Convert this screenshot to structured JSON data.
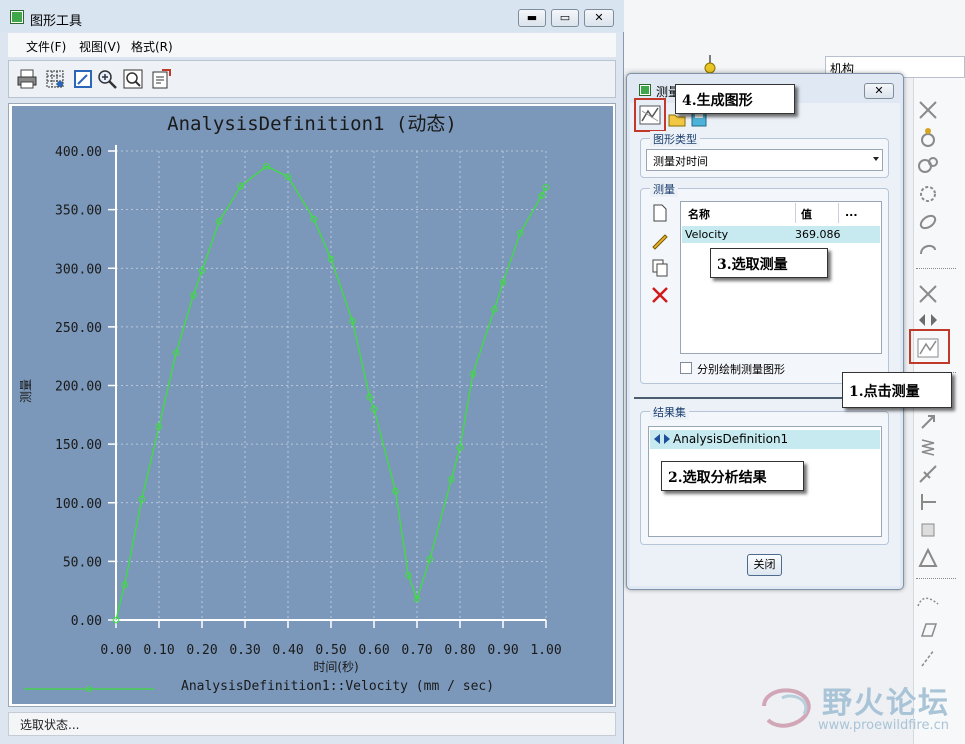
{
  "background_app": {
    "tree_label": "机构",
    "watermark": {
      "site_name": "野火论坛",
      "url": "www.proewildfire.cn"
    }
  },
  "graph_window": {
    "title": "图形工具",
    "window_buttons": {
      "minimize": "▬",
      "maximize": "▭",
      "close": "✕"
    },
    "menu": [
      "文件(F)",
      "视图(V)",
      "格式(R)"
    ],
    "toolbar_icons": [
      "print-icon",
      "grid-icon",
      "edit-axis-icon",
      "zoom-in-icon",
      "zoom-fit-icon",
      "export-icon"
    ],
    "status": "选取状态...",
    "colors": {
      "plot_background": "#7b98ba",
      "series": "#3ddf3d",
      "grid": "#c9d6e6"
    }
  },
  "chart_data": {
    "type": "line",
    "title": "AnalysisDefinition1 (动态)",
    "xlabel": "时间(秒)",
    "ylabel": "测量",
    "xlim": [
      0,
      1
    ],
    "ylim": [
      0,
      400
    ],
    "x_ticks": [
      "0.00",
      "0.10",
      "0.20",
      "0.30",
      "0.40",
      "0.50",
      "0.60",
      "0.70",
      "0.80",
      "0.90",
      "1.00"
    ],
    "y_ticks": [
      "0.00",
      "50.00",
      "100.00",
      "150.00",
      "200.00",
      "250.00",
      "300.00",
      "350.00",
      "400.00"
    ],
    "grid": true,
    "legend": "bottom-left",
    "series": [
      {
        "name": "AnalysisDefinition1::Velocity (mm / sec)",
        "x": [
          0.0,
          0.02,
          0.06,
          0.1,
          0.14,
          0.18,
          0.2,
          0.24,
          0.29,
          0.35,
          0.4,
          0.46,
          0.5,
          0.55,
          0.59,
          0.6,
          0.65,
          0.68,
          0.7,
          0.73,
          0.78,
          0.8,
          0.83,
          0.88,
          0.9,
          0.94,
          0.99,
          1.0
        ],
        "y": [
          0,
          30,
          103,
          165,
          228,
          277,
          298,
          340,
          370,
          387,
          378,
          342,
          308,
          255,
          190,
          180,
          110,
          38,
          18,
          52,
          120,
          147,
          210,
          265,
          288,
          330,
          362,
          369
        ]
      }
    ]
  },
  "measure_dialog": {
    "title": "测量",
    "graph_type_group": "图形类型",
    "graph_type_value": "测量对时间",
    "measure_group": "测量",
    "table_headers": [
      "名称",
      "值",
      "..."
    ],
    "table_rows": [
      {
        "name": "Velocity",
        "value": "369.086"
      }
    ],
    "separate_graph_label": "分别绘制测量图形",
    "result_group": "结果集",
    "result_item": "AnalysisDefinition1",
    "close_button": "关闭",
    "close_x": "✕"
  },
  "callouts": {
    "step1": "1.点击测量",
    "step2": "2.选取分析结果",
    "step3": "3.选取测量",
    "step4": "4.生成图形"
  }
}
